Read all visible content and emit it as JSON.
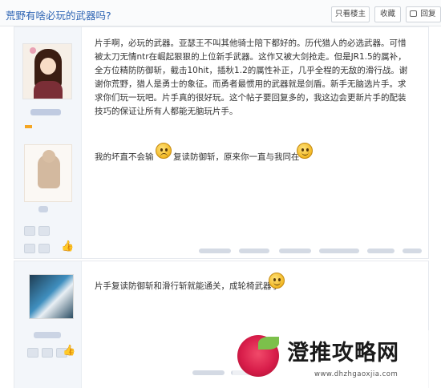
{
  "thread": {
    "title": "荒野有啥必玩的武器吗?",
    "buttons": {
      "only_op": "只看楼主",
      "favorite": "收藏",
      "reply": "回复"
    }
  },
  "post1": {
    "paragraph": "片手啊，必玩的武器。亚瑟王不叫其他骑士陪下都好的。历代猎人的必选武器。可惜被太刀无情ntr在崛起狠狠的上位新手武器。这作又被大剑抢走。但是JR1.5的属补，全方位精防防御斩，截击10hit，插秋1.2的属性补正，几乎全程的无敌的滑行战。谢谢你荒野，猎人是勇士的象征。而勇者最惯用的武器就是剑盾。新手无脑选片手。求求你们玩一玩吧。片手真的很好玩。这个帖子要回复多的，我这边会更新片手的配装技巧的保证让所有人都能无脑玩片手。",
    "line2_a": "我的坏直不会输",
    "line2_b": "复读防御斩，原来你一直与我同在"
  },
  "post2": {
    "text": "片手复读防御斩和滑行斩就能通关，成轮椅武器了"
  },
  "watermark": {
    "title": "澄推攻略网",
    "url": "www.dhzhgaoxjia.com"
  },
  "icons": {
    "smile": "smile-emoji-icon",
    "angry": "angry-emoji-icon",
    "reply": "reply-icon",
    "like": "thumbs-up-icon"
  },
  "colors": {
    "title_blue": "#2d64b3",
    "logo_red": "#d81d4a",
    "leaf_green": "#7cc04b"
  }
}
